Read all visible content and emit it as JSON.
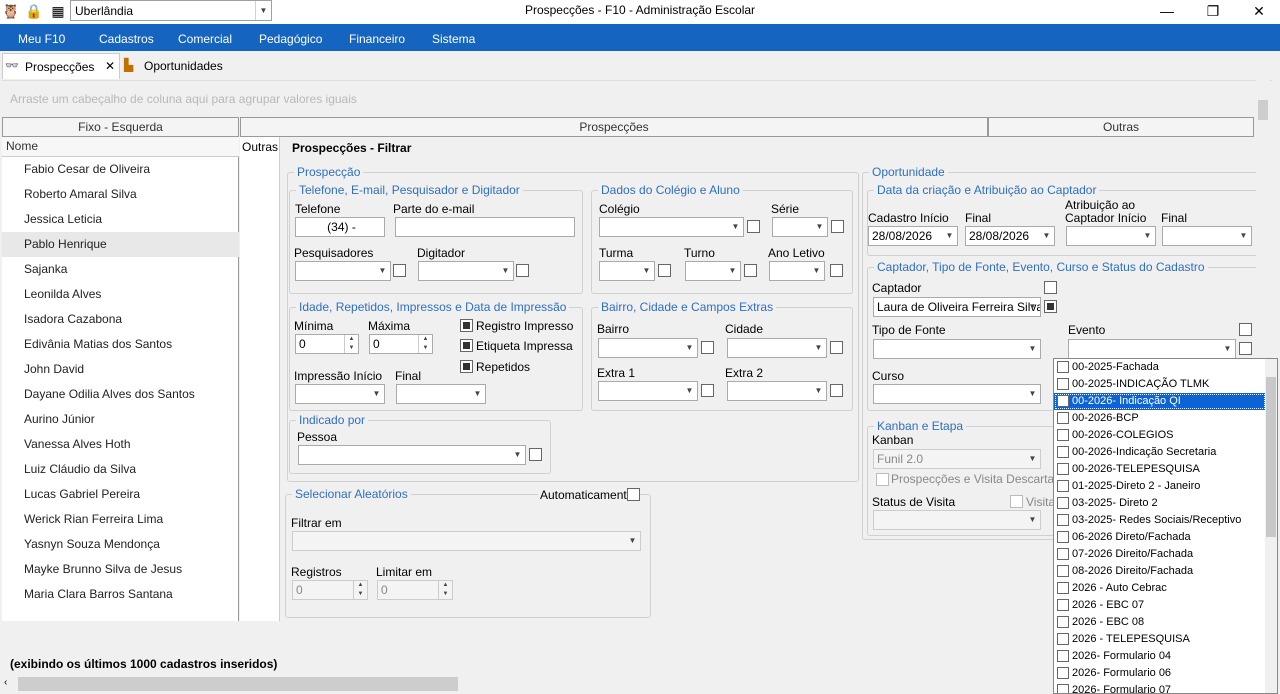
{
  "titlebar": {
    "city": "Uberlândia",
    "title": "Prospecções - F10 - Administração Escolar",
    "minimize": "—",
    "maximize": "❐",
    "close": "✕"
  },
  "menu": {
    "items": [
      "Meu F10",
      "Cadastros",
      "Comercial",
      "Pedagógico",
      "Financeiro",
      "Sistema"
    ]
  },
  "tabs": {
    "prospeccoes": "Prospecções",
    "close": "✕",
    "oportunidades": "Oportunidades"
  },
  "groupbar": {
    "hint": "Arraste um cabeçalho de coluna aqui para agrupar valores iguais"
  },
  "grid": {
    "band_left": "Fixo - Esquerda",
    "band_middle": "Prospecções",
    "band_right": "Outras",
    "col_nome": "Nome",
    "col_outras": "Outras",
    "rows": [
      "Fabio Cesar de Oliveira",
      "Roberto Amaral Silva",
      "Jessica Leticia",
      "Pablo Henrique",
      "Sajanka",
      "Leonilda Alves",
      "Isadora Cazabona",
      "Edivânia Matias dos Santos",
      "John David",
      "Dayane Odilia Alves dos Santos",
      "Aurino Júnior",
      "Vanessa Alves Hoth",
      "Luiz Cláudio da Silva",
      "Lucas Gabriel Pereira",
      "Werick Rian Ferreira Lima",
      "Yasnyn Souza Mendonça",
      "Mayke Brunno Silva de Jesus",
      "Maria Clara Barros Santana"
    ]
  },
  "filter": {
    "title": "Prospecções - Filtrar",
    "prospeccao": {
      "label": "Prospecção",
      "contato": {
        "label": "Telefone, E-mail, Pesquisador e Digitador",
        "telefone": "Telefone",
        "telefone_value": "(34)      -",
        "email": "Parte do e-mail",
        "pesquisadores": "Pesquisadores",
        "digitador": "Digitador"
      },
      "colegio": {
        "label": "Dados do Colégio e Aluno",
        "colegio": "Colégio",
        "serie": "Série",
        "turma": "Turma",
        "turno": "Turno",
        "ano": "Ano Letivo"
      },
      "idade": {
        "label": "Idade, Repetidos, Impressos e Data de Impressão",
        "minima": "Mínima",
        "minima_value": "0",
        "maxima": "Máxima",
        "maxima_value": "0",
        "registro": "Registro Impresso",
        "etiqueta": "Etiqueta Impressa",
        "repetidos": "Repetidos",
        "impressao_inicio": "Impressão Início",
        "final": "Final"
      },
      "bairro": {
        "label": "Bairro, Cidade e Campos Extras",
        "bairro": "Bairro",
        "cidade": "Cidade",
        "extra1": "Extra 1",
        "extra2": "Extra 2"
      },
      "indicado": {
        "label": "Indicado por",
        "pessoa": "Pessoa"
      }
    },
    "aleatorios": {
      "label": "Selecionar Aleatórios",
      "auto": "Automaticamente",
      "filtrar_em": "Filtrar em",
      "registros": "Registros",
      "registros_value": "0",
      "limitar": "Limitar em",
      "limitar_value": "0"
    },
    "oportunidade": {
      "label": "Oportunidade",
      "datas": {
        "label": "Data da criação e Atribuição ao Captador",
        "cad_inicio": "Cadastro Início",
        "cad_inicio_value": "28/08/2026",
        "final": "Final",
        "final_value": "28/08/2026",
        "atrib_line1": "Atribuição ao",
        "atrib_line2": "Captador Início",
        "final2": "Final"
      },
      "captador": {
        "label": "Captador, Tipo de Fonte, Evento, Curso e Status do Cadastro",
        "captador": "Captador",
        "captador_value": "Laura de Oliveira Ferreira Silva",
        "tipo_fonte": "Tipo de Fonte",
        "evento": "Evento",
        "curso": "Curso"
      },
      "kanban": {
        "label": "Kanban e Etapa",
        "kanban": "Kanban",
        "kanban_value": "Funil 2.0",
        "descartados": "Prospecções e Visita Descartados",
        "status": "Status de Visita",
        "visita": "Visita"
      }
    }
  },
  "status": {
    "text": "(exibindo os últimos 1000 cadastros inseridos)"
  },
  "evento_dropdown": {
    "items": [
      "00-2025-Fachada",
      "00-2025-INDICAÇÃO TLMK",
      "00-2026- Indicação QI",
      "00-2026-BCP",
      "00-2026-COLEGIOS",
      "00-2026-Indicação Secretaria",
      "00-2026-TELEPESQUISA",
      "01-2025-Direto 2 - Janeiro",
      "03-2025- Direto 2",
      "03-2025- Redes Sociais/Receptivo",
      "06-2026 Direto/Fachada",
      "07-2026 Direito/Fachada",
      "08-2026 Direito/Fachada",
      "2026 - Auto Cebrac",
      "2026 - EBC 07",
      "2026 - EBC 08",
      "2026 - TELEPESQUISA",
      "2026- Formulario 04",
      "2026- Formulario 06",
      "2026- Formulario 07"
    ],
    "selected_index": 2
  },
  "colors": {
    "menu_bg": "#1565c0",
    "group_label": "#2f6fbf",
    "dropdown_selected": "#0b63d6"
  }
}
